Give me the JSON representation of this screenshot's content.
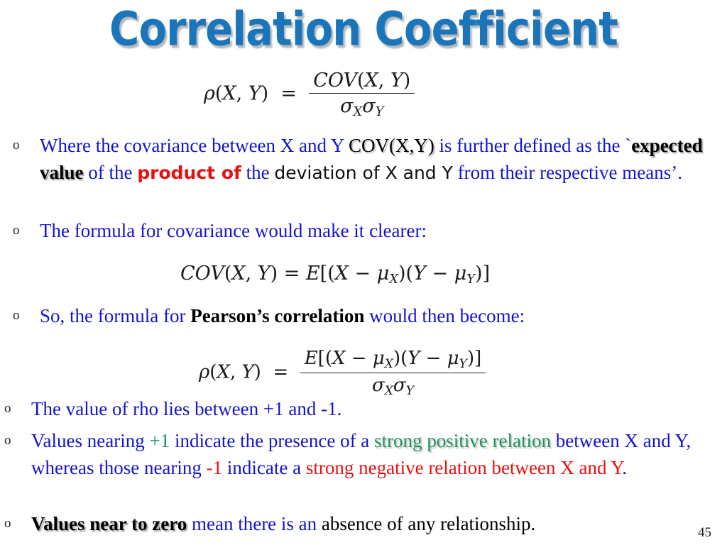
{
  "slide": {
    "title": "Correlation Coefficient",
    "page_number": "45",
    "title_color": "#1B75BB",
    "body_color": "#1414CC",
    "accent_red": "#E81010",
    "accent_green": "#1E9160"
  },
  "formulas": {
    "rho_cov": {
      "lhs": "ρ(X, Y) =",
      "numerator": "COV(X, Y)",
      "denominator": "σXσY",
      "plain": "ρ(X,Y) = COV(X,Y) / (σ_X σ_Y)"
    },
    "covariance": {
      "plain": "COV(X,Y) = E[(X − μ_X)(Y − μ_Y)]",
      "lhs": "COV(X, Y) =",
      "rhs": "E[(X − μX)(Y − μY)]"
    },
    "pearson": {
      "lhs": "ρ(X, Y) =",
      "numerator": "E[(X − μX)(Y − μY)]",
      "denominator": "σXσY",
      "plain": "ρ(X,Y) = E[(X − μ_X)(Y − μ_Y)] / (σ_X σ_Y)"
    }
  },
  "bullets": [
    {
      "marker": "o",
      "runs": [
        {
          "text": "Where the covariance between X and Y ",
          "style": "blue"
        },
        {
          "text": "COV(X,Y)",
          "style": "shadow-plain"
        },
        {
          "text": " is further defined as ",
          "style": "blue"
        },
        {
          "text": "the `",
          "style": "blue"
        },
        {
          "text": "expected value",
          "style": "shadow-black"
        },
        {
          "text": " of the ",
          "style": "blue"
        },
        {
          "text": "product of",
          "style": "rounded-red"
        },
        {
          "text": " the ",
          "style": "blue"
        },
        {
          "text": "deviation of X and Y",
          "style": "geo-black"
        },
        {
          "text": " from their respective means’.",
          "style": "blue"
        }
      ]
    },
    {
      "marker": "o",
      "runs": [
        {
          "text": "The formula for covariance would make it clearer:",
          "style": "blue"
        }
      ]
    },
    {
      "marker": "o",
      "runs": [
        {
          "text": "So, the formula for ",
          "style": "blue"
        },
        {
          "text": "Pearson’s correlation",
          "style": "bold-serif"
        },
        {
          "text": " would then become:",
          "style": "blue"
        }
      ]
    },
    {
      "marker": "o",
      "runs": [
        {
          "text": "The value of rho lies between +1 and -1.",
          "style": "blue"
        }
      ]
    },
    {
      "marker": "o",
      "runs": [
        {
          "text": "Values nearing ",
          "style": "blue"
        },
        {
          "text": "+1",
          "style": "green"
        },
        {
          "text": " indicate the presence of a ",
          "style": "blue"
        },
        {
          "text": "strong positive relation",
          "style": "shadow-green"
        },
        {
          "text": " between X and Y, whereas those nearing ",
          "style": "blue"
        },
        {
          "text": "-1",
          "style": "red"
        },
        {
          "text": " indicate a ",
          "style": "blue"
        },
        {
          "text": "strong negative relation between X and Y",
          "style": "red"
        },
        {
          "text": ".",
          "style": "blue"
        }
      ]
    },
    {
      "marker": "o",
      "runs": [
        {
          "text": "Values near to zero",
          "style": "shadow-black"
        },
        {
          "text": " mean there is an ",
          "style": "blue"
        },
        {
          "text": "absence of any relationship.",
          "style": "black"
        }
      ]
    }
  ]
}
